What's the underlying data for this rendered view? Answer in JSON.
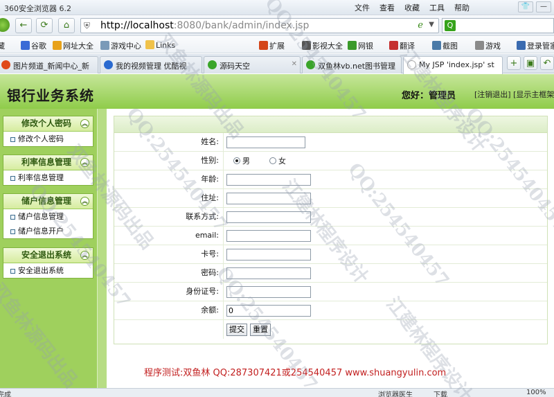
{
  "browser": {
    "title": "360安全浏览器 6.2",
    "menu": [
      "文件",
      "查看",
      "收藏",
      "工具",
      "帮助"
    ],
    "url_host": "http://localhost",
    "url_rest": ":8080/bank/admin/index.jsp",
    "bookmarks": [
      "藏",
      "谷歌",
      "网址大全",
      "游戏中心",
      "Links",
      "扩展",
      "影视大全",
      "网银",
      "翻译",
      "截图",
      "游戏",
      "登录管家"
    ],
    "tabs": [
      {
        "label": "图片频道_新闻中心_新",
        "active": false
      },
      {
        "label": "我的视频管理 优酷视",
        "active": false
      },
      {
        "label": "源码天空",
        "active": false
      },
      {
        "label": "双鱼林vb.net图书管理",
        "active": false
      },
      {
        "label": "My JSP 'index.jsp' st",
        "active": true
      }
    ],
    "status": {
      "left": "完成",
      "middle": "浏览器医生",
      "download": "下载",
      "zoom": "100%"
    }
  },
  "header": {
    "system_title": "银行业务系统",
    "greeting": "您好：管理员",
    "logout_link": "[注销退出]",
    "show_frame_link": "[显示主框架]"
  },
  "sidebar": {
    "groups": [
      {
        "title": "修改个人密码",
        "items": [
          "修改个人密码"
        ]
      },
      {
        "title": "利率信息管理",
        "items": [
          "利率信息管理"
        ]
      },
      {
        "title": "储户信息管理",
        "items": [
          "储户信息管理",
          "储户信息开户"
        ]
      },
      {
        "title": "安全退出系统",
        "items": [
          "安全退出系统"
        ]
      }
    ]
  },
  "form": {
    "fields": [
      {
        "label": "姓名:",
        "value": ""
      },
      {
        "label": "性别:",
        "type": "radio"
      },
      {
        "label": "年龄:",
        "value": ""
      },
      {
        "label": "住址:",
        "value": ""
      },
      {
        "label": "联系方式:",
        "value": ""
      },
      {
        "label": "email:",
        "value": ""
      },
      {
        "label": "卡号:",
        "value": ""
      },
      {
        "label": "密码:",
        "value": ""
      },
      {
        "label": "身份证号:",
        "value": ""
      },
      {
        "label": "余额:",
        "value": "0"
      }
    ],
    "gender_male": "男",
    "gender_female": "女",
    "submit_label": "提交",
    "reset_label": "重置"
  },
  "footer": {
    "credit": "程序测试:双鱼林 QQ:287307421或254540457 www.shuangyulin.com"
  },
  "watermarks": [
    "QQ:254540457",
    "双鱼林源码出品",
    "江建林程序设计"
  ]
}
